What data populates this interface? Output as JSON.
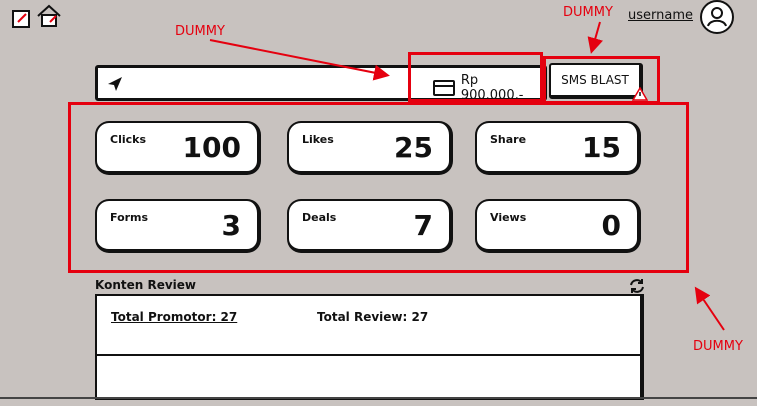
{
  "header": {
    "username": "username"
  },
  "search": {
    "price_label": "Rp 900.000,-"
  },
  "actions": {
    "sms_blast_label": "SMS BLAST"
  },
  "stats": [
    {
      "label": "Clicks",
      "value": "100"
    },
    {
      "label": "Likes",
      "value": "25"
    },
    {
      "label": "Share",
      "value": "15"
    },
    {
      "label": "Forms",
      "value": "3"
    },
    {
      "label": "Deals",
      "value": "7"
    },
    {
      "label": "Views",
      "value": "0"
    }
  ],
  "annotations": {
    "dummy_1": "DUMMY",
    "dummy_2": "DUMMY",
    "dummy_3": "DUMMY"
  },
  "review": {
    "title": "Konten Review",
    "total_promotor": "Total Promotor: 27",
    "total_review": "Total Review: 27"
  },
  "colors": {
    "annotation": "#e5000f",
    "background": "#c8c2bf"
  }
}
